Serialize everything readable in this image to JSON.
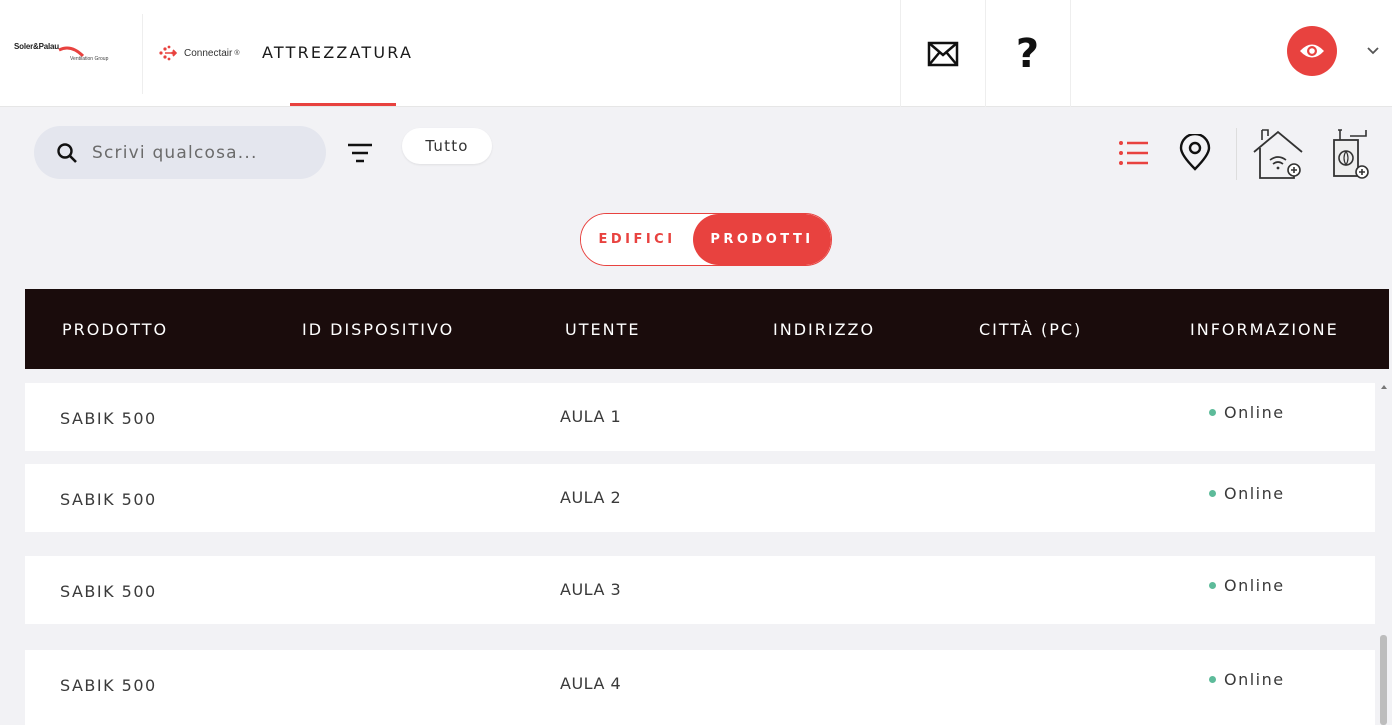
{
  "header": {
    "brand": {
      "name": "Soler&Palau",
      "tagline": "Ventilation Group"
    },
    "product": {
      "name": "Connectair",
      "reg": "®"
    },
    "section_title": "ATTREZZATURA",
    "help_label": "?"
  },
  "toolbar": {
    "search_placeholder": "Scrivi qualcosa...",
    "filter_chip": "Tutto"
  },
  "view_toggle": {
    "options": [
      "EDIFICI",
      "PRODOTTI"
    ],
    "selected": "PRODOTTI"
  },
  "table": {
    "columns": [
      "PRODOTTO",
      "ID DISPOSITIVO",
      "UTENTE",
      "INDIRIZZO",
      "CITTÀ (PC)",
      "INFORMAZIONE"
    ],
    "rows": [
      {
        "product": "SABIK 500",
        "device_id": "",
        "user": "AULA 1",
        "address": "",
        "city": "",
        "status": "Online"
      },
      {
        "product": "SABIK 500",
        "device_id": "",
        "user": "AULA 2",
        "address": "",
        "city": "",
        "status": "Online"
      },
      {
        "product": "SABIK 500",
        "device_id": "",
        "user": "AULA 3",
        "address": "",
        "city": "",
        "status": "Online"
      },
      {
        "product": "SABIK 500",
        "device_id": "",
        "user": "AULA 4",
        "address": "",
        "city": "",
        "status": "Online"
      }
    ]
  },
  "colors": {
    "accent": "#e8423f",
    "header_bg": "#1a0c0c",
    "online": "#5dbb9a",
    "page_bg": "#f2f2f5"
  }
}
